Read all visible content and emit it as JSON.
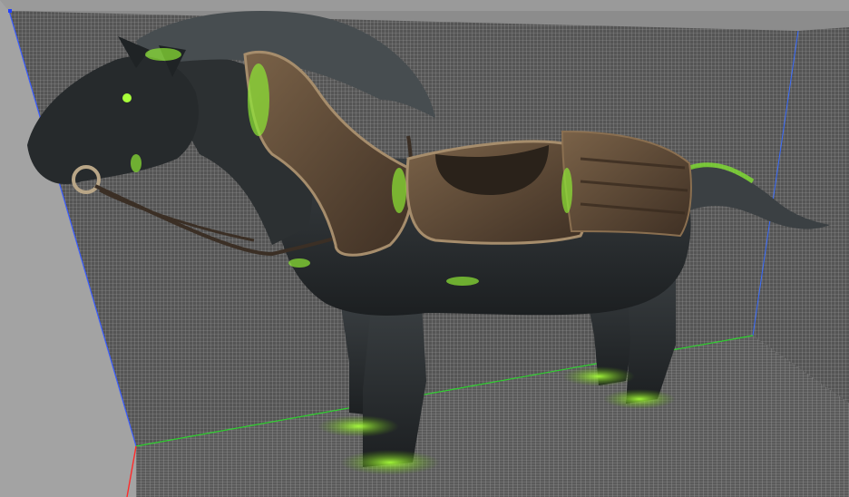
{
  "viewport": {
    "label": "",
    "colors": {
      "outer_gray": "#8f8f8f",
      "grid_fill": "#4d4d4d",
      "grid_line": "#9a9a9a",
      "axis_x": "#2fd02f",
      "axis_y": "#3a5cff",
      "axis_z": "#ff2a2a",
      "horse_body": "#2a2d2f",
      "armor": "#5a4634",
      "armor_edge": "#a68d6c",
      "glow": "#7fe030"
    }
  },
  "model": {
    "name_icon": "armored-horse-model"
  }
}
